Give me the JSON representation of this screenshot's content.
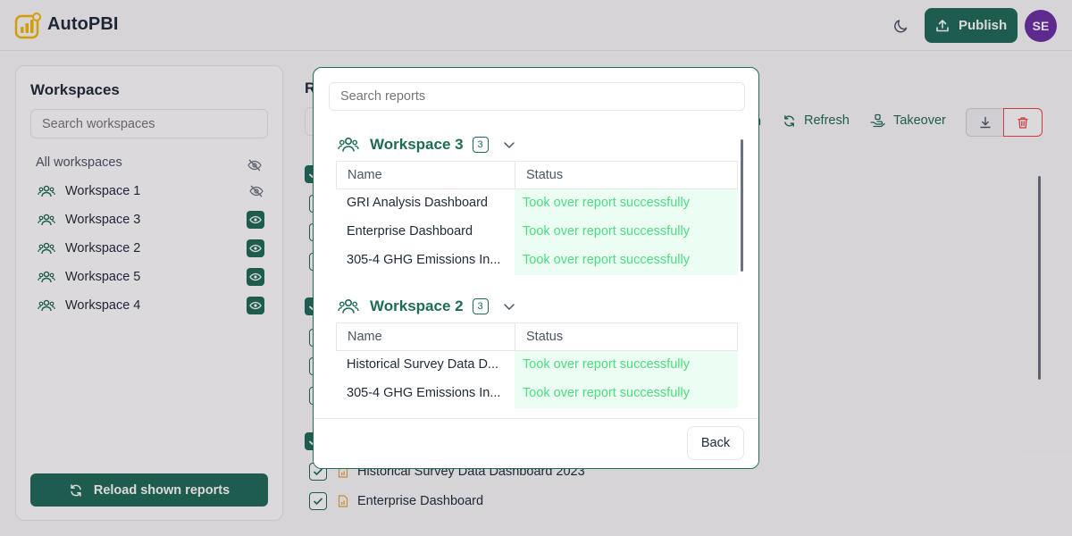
{
  "header": {
    "app_title": "AutoPBI",
    "publish_label": "Publish",
    "avatar_initials": "SE",
    "theme_icon": "moon-icon"
  },
  "colors": {
    "brand": "#1e6b58",
    "success_text": "#4ade80",
    "success_bg": "#ecfdf3",
    "danger": "#ef4444",
    "avatar": "#6b2fa1",
    "logo": "#f5b800"
  },
  "sidebar": {
    "title": "Workspaces",
    "search_placeholder": "Search workspaces",
    "all_label": "All workspaces",
    "items": [
      {
        "label": "Workspace 1",
        "visible": false
      },
      {
        "label": "Workspace 3",
        "visible": true
      },
      {
        "label": "Workspace 2",
        "visible": true
      },
      {
        "label": "Workspace 5",
        "visible": true
      },
      {
        "label": "Workspace 4",
        "visible": true
      }
    ],
    "reload_label": "Reload shown reports"
  },
  "main": {
    "title_partial": "R",
    "toolbar": {
      "partial_label": "n",
      "refresh_label": "Refresh",
      "takeover_label": "Takeover"
    },
    "report_rows": [
      {
        "name": "Historical Survey Data Dashboard 2023"
      },
      {
        "name": "Enterprise Dashboard"
      }
    ]
  },
  "modal": {
    "search_placeholder": "Search reports",
    "columns": {
      "name": "Name",
      "status": "Status"
    },
    "groups": [
      {
        "name": "Workspace 3",
        "count": "3",
        "rows": [
          {
            "name": "GRI Analysis Dashboard",
            "status": "Took over report successfully"
          },
          {
            "name": "Enterprise Dashboard",
            "status": "Took over report successfully"
          },
          {
            "name": "305-4 GHG Emissions In...",
            "status": "Took over report successfully"
          }
        ]
      },
      {
        "name": "Workspace 2",
        "count": "3",
        "rows": [
          {
            "name": "Historical Survey Data D...",
            "status": "Took over report successfully"
          },
          {
            "name": "305-4 GHG Emissions In...",
            "status": "Took over report successfully"
          }
        ]
      }
    ],
    "back_label": "Back"
  }
}
